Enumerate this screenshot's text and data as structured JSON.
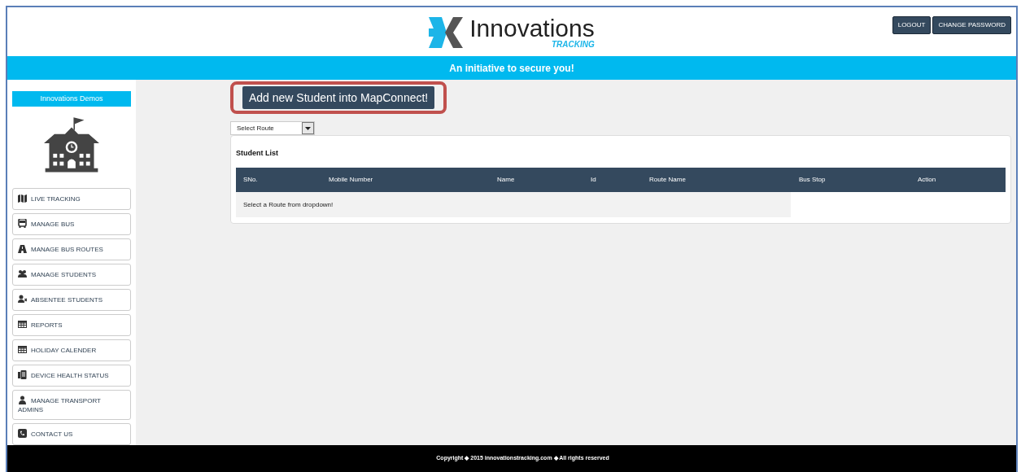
{
  "header": {
    "logo_text": "Innovations",
    "logo_subtext": "TRACKING",
    "buttons": [
      "LOGOUT",
      "CHANGE PASSWORD"
    ]
  },
  "banner": "An initiative to secure you!",
  "sidebar": {
    "account": "Innovations Demos",
    "items": [
      {
        "label": "LIVE TRACKING"
      },
      {
        "label": "MANAGE BUS"
      },
      {
        "label": "MANAGE BUS ROUTES"
      },
      {
        "label": "MANAGE STUDENTS"
      },
      {
        "label": "ABSENTEE STUDENTS"
      },
      {
        "label": "REPORTS"
      },
      {
        "label": "HOLIDAY CALENDER"
      },
      {
        "label": "DEVICE HEALTH STATUS"
      },
      {
        "label": "MANAGE TRANSPORT ADMINS"
      },
      {
        "label": "CONTACT US"
      }
    ]
  },
  "add_button": "Add new Student into MapConnect!",
  "route_select": {
    "value": "Select Route"
  },
  "student_list": {
    "title": "Student List",
    "columns": [
      "SNo.",
      "Mobile Number",
      "Name",
      "Id",
      "Route Name",
      "Bus Stop",
      "Action"
    ],
    "empty_message": "Select a Route from dropdown!"
  },
  "footer": "Copyright ◆ 2015 innovationstracking.com ◆ All rights reserved"
}
